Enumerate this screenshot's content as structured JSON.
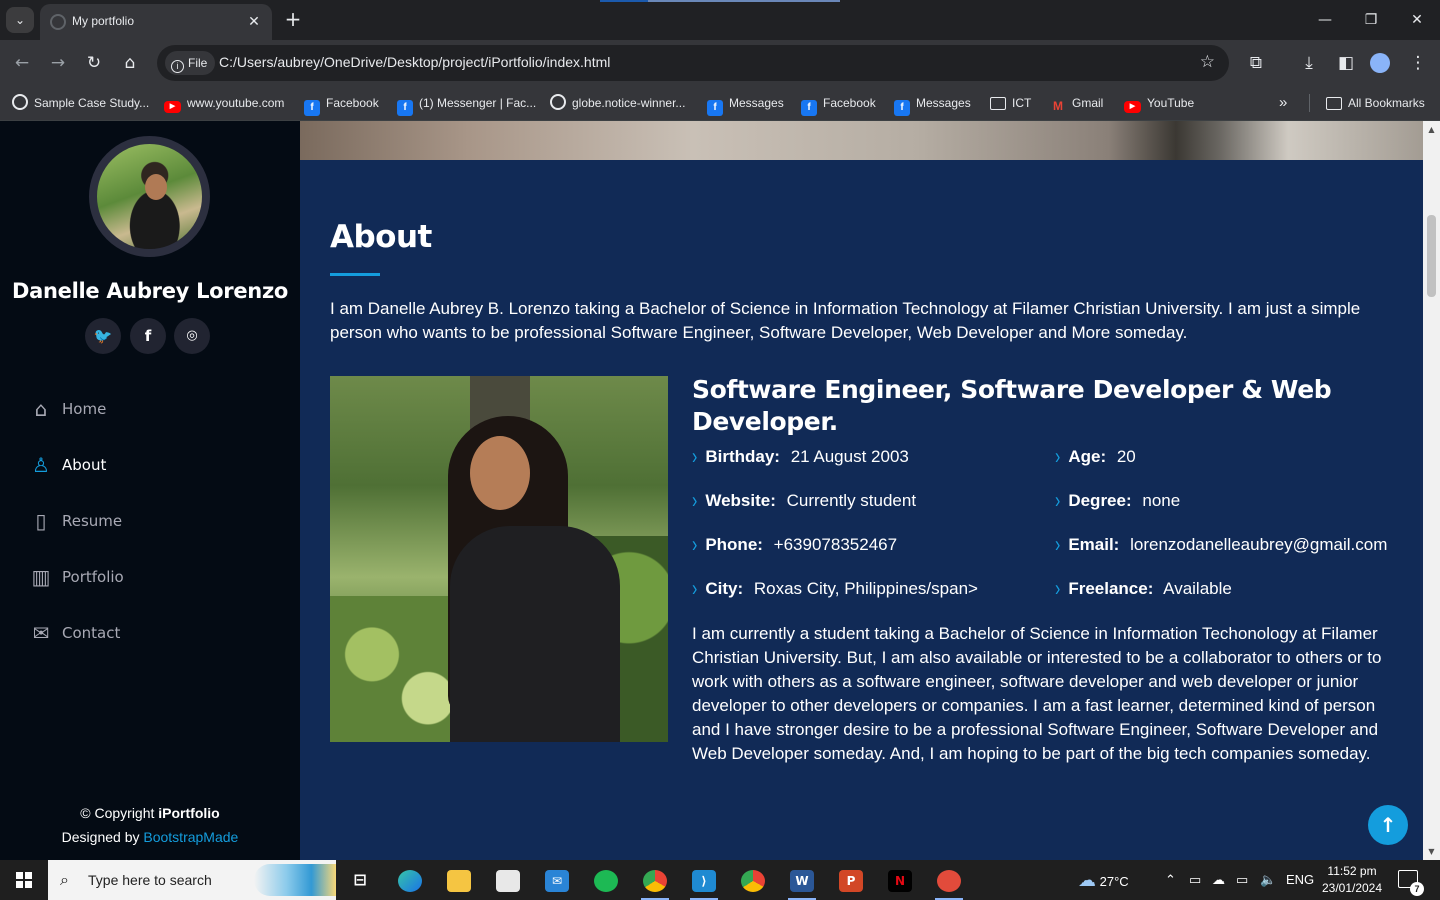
{
  "browser": {
    "tab_title": "My portfolio",
    "tab_close": "✕",
    "new_tab": "+",
    "url_scheme_label": "File",
    "url": "C:/Users/aubrey/OneDrive/Desktop/project/iPortfolio/index.html",
    "bookmarks": [
      {
        "label": "Sample Case Study...",
        "icon": "globe-icon"
      },
      {
        "label": "www.youtube.com",
        "icon": "youtube-icon"
      },
      {
        "label": "Facebook",
        "icon": "facebook-icon"
      },
      {
        "label": "(1) Messenger | Fac...",
        "icon": "facebook-icon"
      },
      {
        "label": "globe.notice-winner...",
        "icon": "globe-icon"
      },
      {
        "label": "Messages",
        "icon": "facebook-icon"
      },
      {
        "label": "Facebook",
        "icon": "facebook-icon"
      },
      {
        "label": "Messages",
        "icon": "facebook-icon"
      },
      {
        "label": "ICT",
        "icon": "folder-icon"
      },
      {
        "label": "Gmail",
        "icon": "gmail-icon"
      },
      {
        "label": "YouTube",
        "icon": "youtube-icon"
      }
    ],
    "more_bookmarks": "»",
    "all_bookmarks": "All Bookmarks"
  },
  "sidebar": {
    "name": "Danelle Aubrey Lorenzo",
    "social": [
      {
        "name": "twitter",
        "glyph": "🐦"
      },
      {
        "name": "facebook",
        "glyph": "f"
      },
      {
        "name": "instagram",
        "glyph": "◎"
      }
    ],
    "nav": [
      {
        "label": "Home",
        "icon": "home-icon",
        "active": false
      },
      {
        "label": "About",
        "icon": "person-icon",
        "active": true
      },
      {
        "label": "Resume",
        "icon": "file-icon",
        "active": false
      },
      {
        "label": "Portfolio",
        "icon": "book-icon",
        "active": false
      },
      {
        "label": "Contact",
        "icon": "envelope-icon",
        "active": false
      }
    ],
    "footer": {
      "copyright_prefix": "© Copyright ",
      "brand": "iPortfolio",
      "designed_by": "Designed by ",
      "designer": "BootstrapMade"
    }
  },
  "about": {
    "title": "About",
    "intro": "I am Danelle Aubrey B. Lorenzo taking a Bachelor of Science in Information Technology at Filamer Christian University. I am just a simple person who wants to be professional Software Engineer, Software Developer, Web Developer and More someday.",
    "role": "Software Engineer, Software Developer & Web Developer.",
    "facts_left": [
      {
        "key": "Birthday:",
        "value": "21 August 2003"
      },
      {
        "key": "Website:",
        "value": "Currently student"
      },
      {
        "key": "Phone:",
        "value": "+639078352467"
      },
      {
        "key": "City:",
        "value": "Roxas City, Philippines/span>"
      }
    ],
    "facts_right": [
      {
        "key": "Age:",
        "value": "20"
      },
      {
        "key": "Degree:",
        "value": "none"
      },
      {
        "key": "Email:",
        "value": "lorenzodanelleaubrey@gmail.com"
      },
      {
        "key": "Freelance:",
        "value": "Available"
      }
    ],
    "paragraph": "I am currently a student taking a Bachelor of Science in Information Techonology at Filamer Christian University. But, I am also available or interested to be a collaborator to others or to work with others as a software engineer, software developer and web developer or junior developer to other developers or companies. I am a fast learner, determined kind of person and I have stronger desire to be a professional Software Engineer, Software Developer and Web Developer someday. And, I am hoping to be part of the big tech companies someday."
  },
  "taskbar": {
    "search_placeholder": "Type here to search",
    "weather": "27°C",
    "language": "ENG",
    "time": "11:52 pm",
    "date": "23/01/2024",
    "notification_count": "7"
  },
  "colors": {
    "accent": "#149ddd",
    "sidebar_bg": "#040b14",
    "main_bg": "#112a56"
  }
}
